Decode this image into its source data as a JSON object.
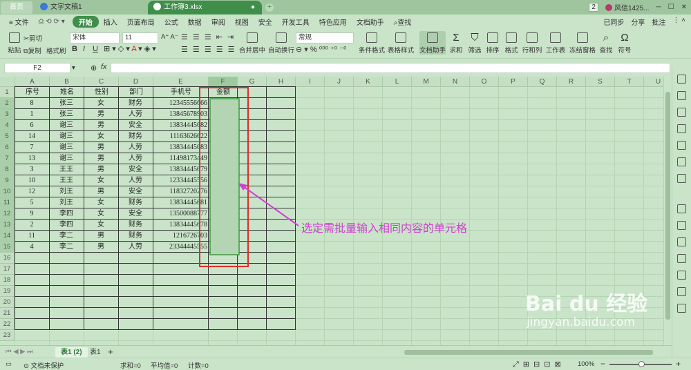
{
  "tabs": {
    "home": "首页",
    "doc": "文字文稿1",
    "workbook": "工作簿3.xlsx",
    "workbook_dot": "●"
  },
  "topright": {
    "badge": "2",
    "user": "风信1425...",
    "min": "─",
    "max": "☐",
    "close": "✕"
  },
  "menu": {
    "file": "≡ 文件",
    "items": [
      "开始",
      "插入",
      "页面布局",
      "公式",
      "数据",
      "审阅",
      "视图",
      "安全",
      "开发工具",
      "特色应用",
      "文档助手"
    ],
    "search": "查找",
    "synced": "已同步",
    "share": "分享",
    "comment": "批注"
  },
  "ribbon": {
    "paste": "粘贴",
    "cut": "剪切",
    "copy": "复制",
    "format_painter": "格式刷",
    "font": "宋体",
    "font_size": "11",
    "bold": "B",
    "italic": "I",
    "underline": "U",
    "merge": "合并居中",
    "wrap": "自动换行",
    "num_format": "常规",
    "cond_format": "条件格式",
    "table_style": "表格样式",
    "doc_helper": "文档助手",
    "sum": "求和",
    "filter": "筛选",
    "sort": "排序",
    "format": "格式",
    "rowcol": "行和列",
    "worksheet": "工作表",
    "freeze": "冻结窗格",
    "find": "查找",
    "symbol": "符号"
  },
  "formula_bar": {
    "cell_ref": "F2",
    "fx": "fx",
    "content": ""
  },
  "columns": [
    "A",
    "B",
    "C",
    "D",
    "E",
    "F",
    "G",
    "H",
    "I",
    "J",
    "K",
    "L",
    "M",
    "N",
    "O",
    "P",
    "Q",
    "R",
    "S",
    "T",
    "U"
  ],
  "headers": [
    "序号",
    "姓名",
    "性别",
    "部门",
    "手机号",
    "金额"
  ],
  "rows": [
    [
      "8",
      "张三",
      "女",
      "财务",
      "12345556666"
    ],
    [
      "1",
      "张三",
      "男",
      "人劳",
      "13845678903"
    ],
    [
      "6",
      "谢三",
      "男",
      "安全",
      "13834445682"
    ],
    [
      "14",
      "谢三",
      "女",
      "财务",
      "11163626622"
    ],
    [
      "7",
      "谢三",
      "男",
      "人劳",
      "13834445683"
    ],
    [
      "13",
      "谢三",
      "男",
      "人劳",
      "11498173449"
    ],
    [
      "3",
      "王王",
      "男",
      "安全",
      "13834445679"
    ],
    [
      "10",
      "王王",
      "女",
      "人劳",
      "12334445556"
    ],
    [
      "12",
      "刘王",
      "男",
      "安全",
      "11832720276"
    ],
    [
      "5",
      "刘王",
      "女",
      "财务",
      "13834445681"
    ],
    [
      "9",
      "李四",
      "女",
      "安全",
      "13500088777"
    ],
    [
      "2",
      "李四",
      "女",
      "财务",
      "13834445678"
    ],
    [
      "11",
      "李二",
      "男",
      "财务",
      "1216726703"
    ],
    [
      "4",
      "李二",
      "男",
      "人劳",
      "23344445555"
    ]
  ],
  "row_numbers": [
    "1",
    "2",
    "3",
    "4",
    "5",
    "6",
    "7",
    "8",
    "9",
    "10",
    "11",
    "12",
    "13",
    "14",
    "15",
    "16",
    "17",
    "18",
    "19",
    "20",
    "21",
    "22",
    "23"
  ],
  "annotation": "选定需批量输入相同内容的单元格",
  "sheets": [
    "表1 (2)",
    "表1"
  ],
  "status": {
    "protect": "文档未保护",
    "sum": "求和=0",
    "avg": "平均值=0",
    "count": "计数=0",
    "zoom": "100%"
  },
  "watermark": {
    "logo": "Bai du 经验",
    "url": "jingyan.baidu.com"
  },
  "colors": {
    "accent": "#3f8f4a",
    "annotation": "#d23fd2",
    "selection_box": "#e02b2b"
  }
}
